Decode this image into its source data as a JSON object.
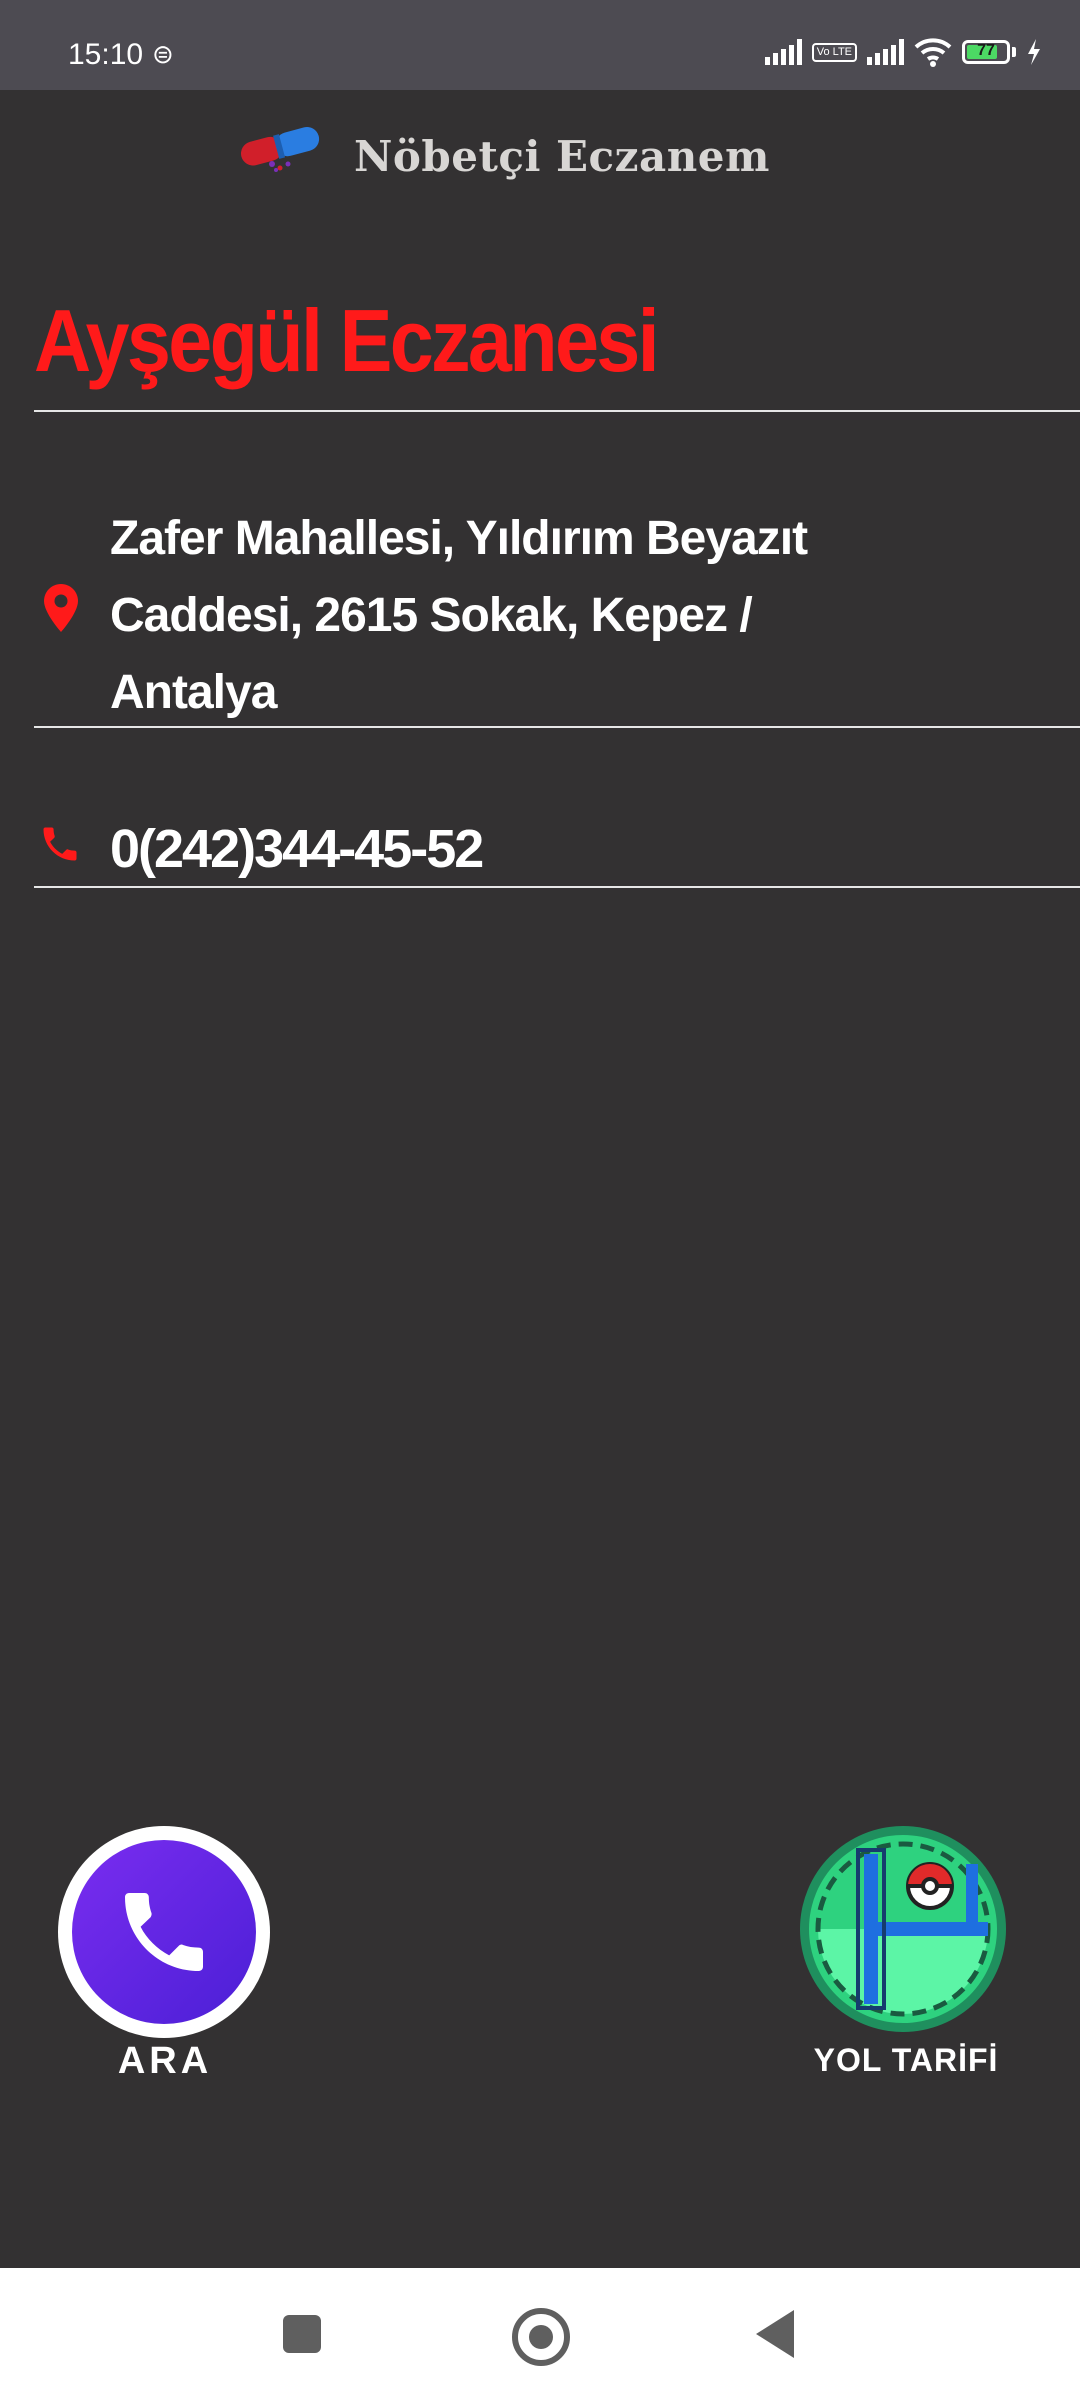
{
  "status_bar": {
    "time": "15:10",
    "sim_icon": "sim-card-icon",
    "volte": "Vo LTE",
    "battery_level": "77",
    "icons": [
      "signal-icon",
      "volte-icon",
      "signal-icon",
      "wifi-icon",
      "battery-icon",
      "charging-icon"
    ]
  },
  "header": {
    "title": "Nöbetçi Eczanem",
    "logo_icon": "pill-capsule-logo"
  },
  "pharmacy": {
    "name": "Ayşegül Eczanesi",
    "address": "Zafer Mahallesi, Yıldırım Beyazıt Caddesi, 2615 Sokak, Kepez / Antalya",
    "phone": "0(242)344-45-52"
  },
  "actions": {
    "call_label": "ARA",
    "directions_label": "YOL TARİFİ"
  },
  "colors": {
    "background": "#333132",
    "accent": "#ff1a1a",
    "call_button": "#5b23e0",
    "map_button": "#2ed27f"
  }
}
